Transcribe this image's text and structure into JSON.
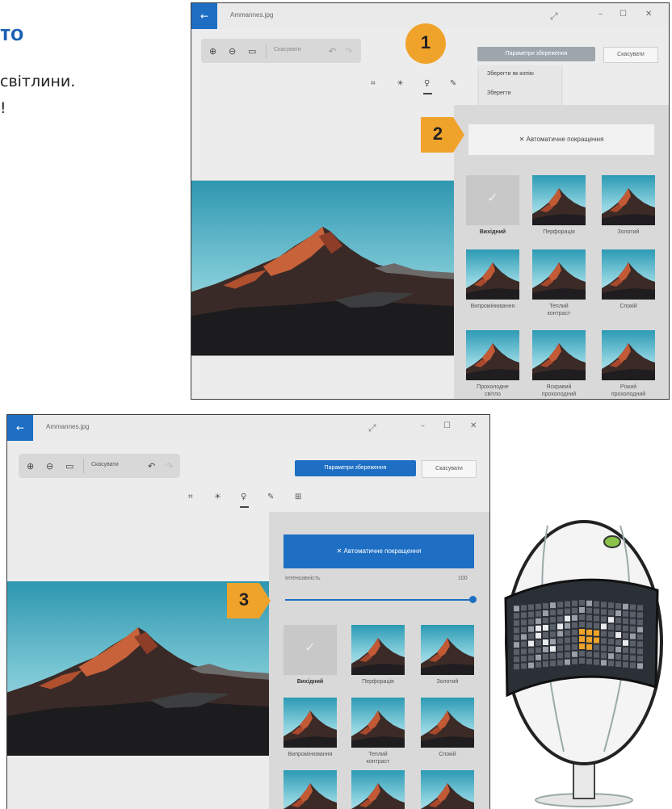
{
  "page": {
    "heading_fragment": "то",
    "text_line_1": "світлини.",
    "text_line_2": "!"
  },
  "window_top": {
    "title": "Ammannes.jpg",
    "zoom_in_icon": "zoom-in-icon",
    "zoom_out_icon": "zoom-out-icon",
    "fit_icon": "fit-screen-icon",
    "undo_label": "Скасувати",
    "save_button_label": "Параметри збереження",
    "cancel_label": "Скасувати",
    "save_menu": [
      "Зберегти як копію",
      "Зберегти"
    ],
    "auto_enhance_label": "Автоматичне покращення",
    "filters": [
      {
        "label": "Вихідний",
        "original": true
      },
      {
        "label": "Перфорація"
      },
      {
        "label": "Золотий"
      },
      {
        "label": "Випромінювання"
      },
      {
        "label": "Теплий контраст"
      },
      {
        "label": "Спокій"
      },
      {
        "label": "Прохолодне світло"
      },
      {
        "label": "Яскравий прохолодний"
      },
      {
        "label": "Різкий прохолодний"
      }
    ]
  },
  "window_bottom": {
    "title": "Ammannes.jpg",
    "undo_label": "Скасувати",
    "save_button_label": "Параметри збереження",
    "cancel_label": "Скасувати",
    "auto_enhance_label": "Автоматичне покращення",
    "intensity_label": "Інтенсивність",
    "intensity_value": "100",
    "intensity_fraction": 1.0,
    "filters": [
      {
        "label": "Вихідний",
        "original": true
      },
      {
        "label": "Перфорація"
      },
      {
        "label": "Золотий"
      },
      {
        "label": "Випромінювання"
      },
      {
        "label": "Теплий контраст"
      },
      {
        "label": "Спокій"
      }
    ]
  },
  "badges": [
    "1",
    "2",
    "3"
  ],
  "colors": {
    "accent_blue": "#1e6fc4",
    "badge_orange": "#f0a32a",
    "heading_blue": "#1a5fb4"
  }
}
